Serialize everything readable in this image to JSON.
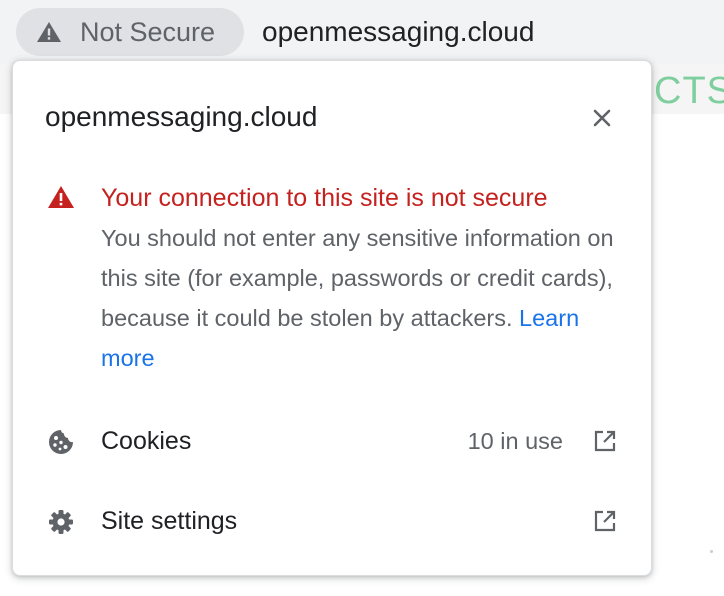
{
  "address_bar": {
    "security_chip_label": "Not Secure",
    "security_chip_icon": "warning-triangle-icon",
    "url": "openmessaging.cloud"
  },
  "background_page": {
    "visible_fragment": "CTS"
  },
  "popup": {
    "title": "openmessaging.cloud",
    "close_icon": "close-icon",
    "warning": {
      "icon": "warning-triangle-icon",
      "heading": "Your connection to this site is not secure",
      "body": "You should not enter any sensitive information on this site (for example, passwords or credit cards), because it could be stolen by attackers.",
      "learn_more": "Learn more"
    },
    "cookies": {
      "icon": "cookie-icon",
      "label": "Cookies",
      "value": "10 in use",
      "action_icon": "external-link-icon"
    },
    "site_settings": {
      "icon": "gear-icon",
      "label": "Site settings",
      "action_icon": "external-link-icon"
    }
  },
  "colors": {
    "warning_red": "#c5221f",
    "link_blue": "#1a73e8",
    "secondary_text": "#5f6368",
    "primary_text": "#202124",
    "chip_background": "#dfe1e5"
  }
}
